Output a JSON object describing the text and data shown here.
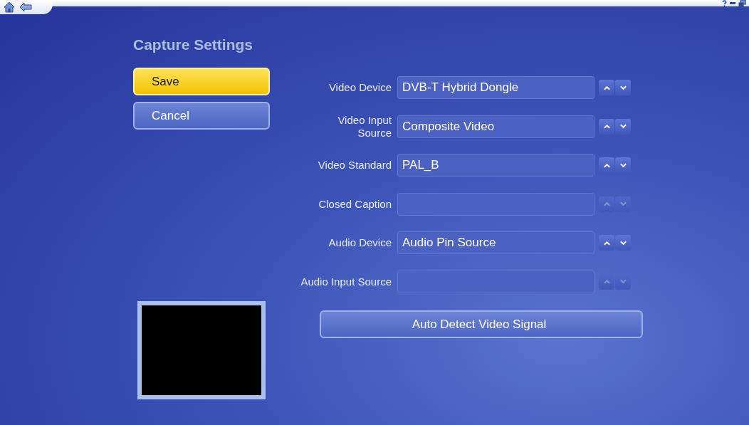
{
  "title": "Capture Settings",
  "buttons": [
    {
      "label": "Save",
      "focused": true
    },
    {
      "label": "Cancel",
      "focused": false
    }
  ],
  "settings": [
    {
      "label": "Video Device",
      "wrap": false,
      "value": "DVB-T Hybrid Dongle",
      "disabled": false
    },
    {
      "label": "Video Input Source",
      "wrap": true,
      "value": "Composite Video",
      "disabled": false
    },
    {
      "label": "Video Standard",
      "wrap": false,
      "value": "PAL_B",
      "disabled": false
    },
    {
      "label": "Closed Caption",
      "wrap": false,
      "disabled": true
    },
    {
      "label": "Audio Device",
      "wrap": false,
      "value": "Audio Pin Source",
      "disabled": false
    },
    {
      "label": "Audio Input Source",
      "wrap": false,
      "disabled": true
    }
  ],
  "detect_button": {
    "label": "Auto Detect Video Signal",
    "focused": false
  }
}
